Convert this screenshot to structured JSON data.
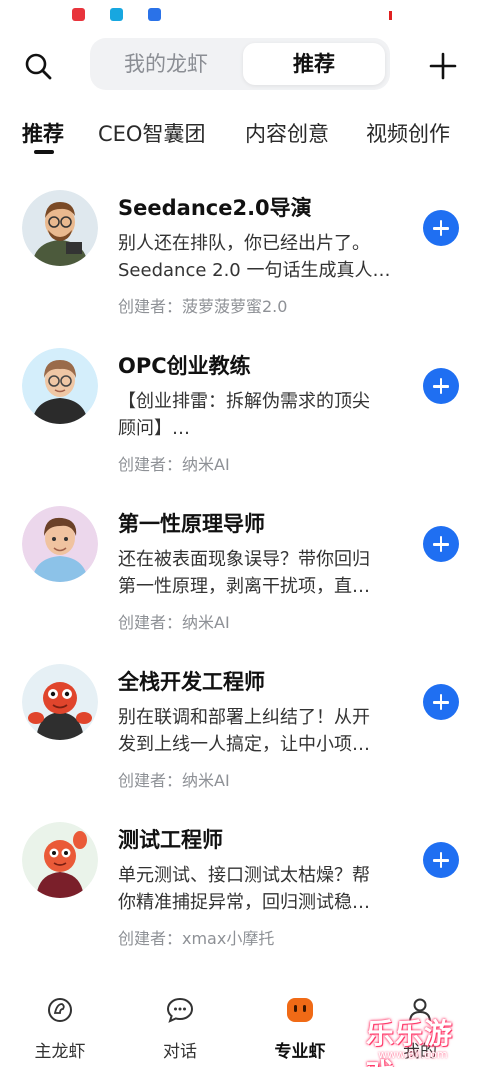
{
  "header": {
    "segments": [
      "我的龙虾",
      "推荐"
    ],
    "active_segment": "推荐"
  },
  "tabs": [
    "推荐",
    "CEO智囊团",
    "内容创意",
    "视频创作"
  ],
  "agents": [
    {
      "name": "Seedance2.0导演",
      "desc_line1": "别人还在排队，你已经出片了。",
      "desc_line2": "Seedance 2.0 一句话生成真人…",
      "creator": "创建者：菠萝菠萝蜜2.0"
    },
    {
      "name": "OPC创业教练",
      "desc_line1": "【创业排雷：拆解伪需求的顶尖",
      "desc_line2": "顾问】…",
      "creator": "创建者：纳米AI"
    },
    {
      "name": "第一性原理导师",
      "desc_line1": "还在被表面现象误导？带你回归",
      "desc_line2": "第一性原理，剥离干扰项，直…",
      "creator": "创建者：纳米AI"
    },
    {
      "name": "全栈开发工程师",
      "desc_line1": "别在联调和部署上纠结了！从开",
      "desc_line2": "发到上线一人搞定，让中小项…",
      "creator": "创建者：纳米AI"
    },
    {
      "name": "测试工程师",
      "desc_line1": "单元测试、接口测试太枯燥？帮",
      "desc_line2": "你精准捕捉异常，回归测试稳…",
      "creator": "创建者：xmax小摩托"
    }
  ],
  "bottom_nav": [
    {
      "label": "主龙虾",
      "icon": "lobster-claw-icon"
    },
    {
      "label": "对话",
      "icon": "chat-bubble-icon"
    },
    {
      "label": "专业虾",
      "icon": "pro-lobster-icon"
    },
    {
      "label": "我的",
      "icon": "profile-icon"
    }
  ],
  "active_nav": "专业虾",
  "watermark": {
    "text": "乐乐游戏",
    "url": "www.6ll.com"
  },
  "colors": {
    "accent": "#1f6ff2",
    "pro_icon": "#f06a16",
    "segment_bg": "#f1f2f4"
  }
}
